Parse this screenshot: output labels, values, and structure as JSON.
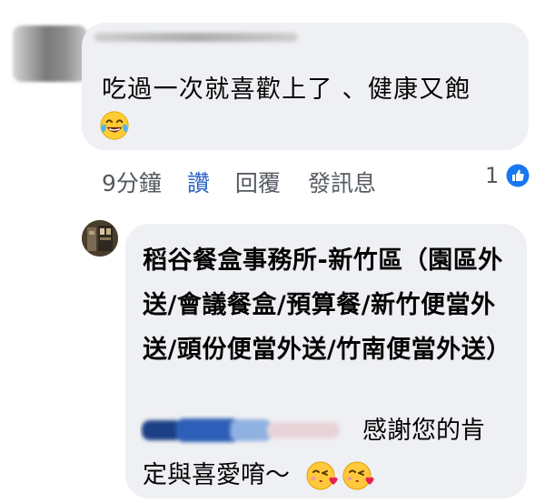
{
  "comment": {
    "text": "吃過一次就喜歡上了 、健康又飽",
    "emoji": "face-with-tears-of-joy"
  },
  "actions": {
    "time": "9分鐘",
    "like": "讚",
    "reply": "回覆",
    "message": "發訊息"
  },
  "reactions": {
    "count": "1",
    "icon": "like-icon",
    "color": "#1877f2"
  },
  "reply": {
    "author": "稻谷餐盒事務所-新竹區（園區外送/會議餐盒/預算餐/新竹便當外送/頭份便當外送/竹南便當外送）",
    "text_line1": "感謝您的肯",
    "text_line2": "定與喜愛唷～",
    "emojis": [
      "kissing-face-with-heart",
      "kissing-face-with-heart"
    ]
  }
}
